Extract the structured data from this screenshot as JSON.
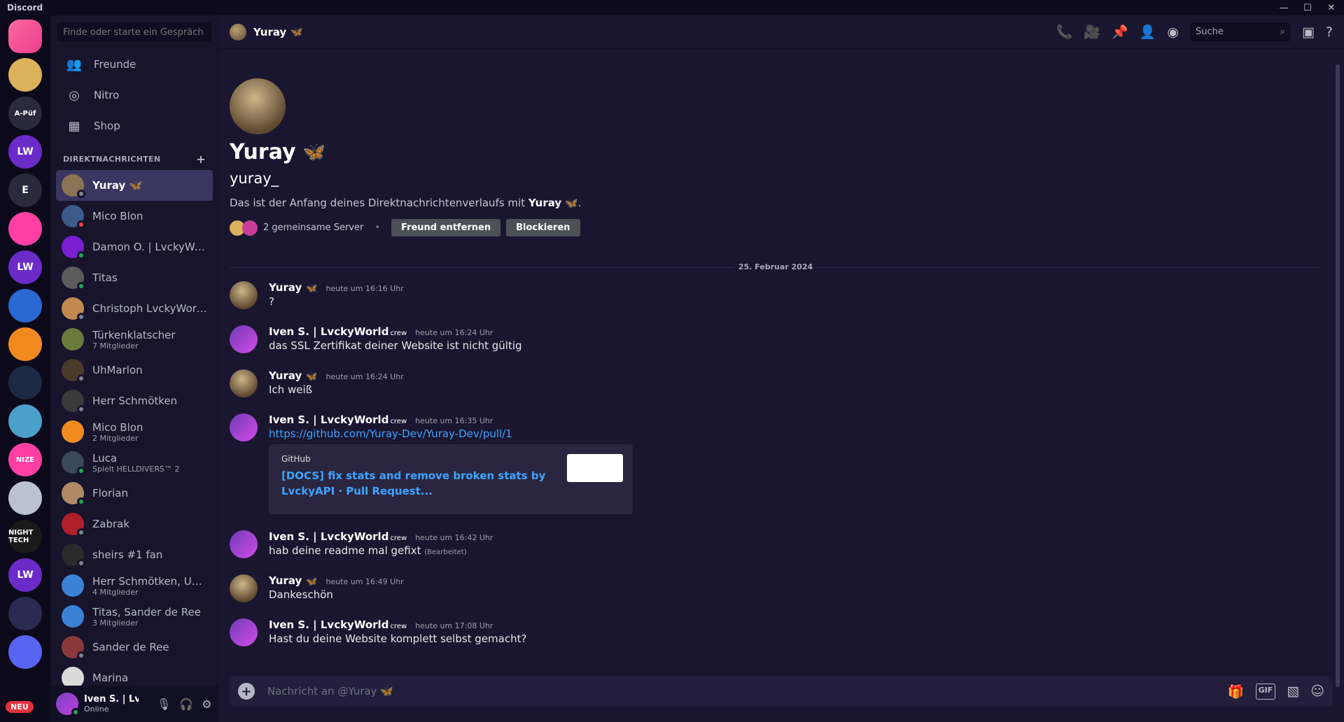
{
  "window": {
    "title": "Discord"
  },
  "servers": [
    {
      "label": "",
      "color": "#e93d8a",
      "dm": true
    },
    {
      "label": "",
      "color": "#d9b25a"
    },
    {
      "label": "A-Püf",
      "color": "#2b2a3d"
    },
    {
      "label": "LW",
      "color": "#6a2bc9"
    },
    {
      "label": "E",
      "color": "#2b2a3d"
    },
    {
      "label": "",
      "color": "#ff3fa3"
    },
    {
      "label": "LW",
      "color": "#6a2bc9"
    },
    {
      "label": "",
      "color": "#2a68d4"
    },
    {
      "label": "",
      "color": "#f08a1f"
    },
    {
      "label": "",
      "color": "#1d2944"
    },
    {
      "label": "",
      "color": "#4aa0c8"
    },
    {
      "label": "NIZE",
      "color": "#ff3fa3"
    },
    {
      "label": "",
      "color": "#b9c2ce"
    },
    {
      "label": "NIGHT TECH",
      "color": "#1a1a1a"
    },
    {
      "label": "LW",
      "color": "#6a2bc9"
    },
    {
      "label": "",
      "color": "#2a2a52"
    },
    {
      "label": "",
      "color": "#5865f2"
    }
  ],
  "neu_badge": "NEU",
  "sidebar": {
    "search_placeholder": "Finde oder starte ein Gespräch",
    "nav": [
      {
        "label": "Freunde"
      },
      {
        "label": "Nitro"
      },
      {
        "label": "Shop"
      }
    ],
    "dm_header": "DIREKTNACHRICHTEN",
    "dms": [
      {
        "name": "Yuray 🦋",
        "sub": "",
        "color": "#8a7456",
        "status": "#80848e",
        "active": true
      },
      {
        "name": "Mico Blon",
        "sub": "",
        "color": "#3c5b8a",
        "status": "#f23f43"
      },
      {
        "name": "Damon O. | LvckyWorl...",
        "sub": "",
        "color": "#7a1fd1",
        "status": "#23a55a"
      },
      {
        "name": "Titas",
        "sub": "",
        "color": "#5b5b5b",
        "status": "#23a55a"
      },
      {
        "name": "Christoph LvckyWorld...",
        "sub": "",
        "color": "#c28a4e",
        "status": "#80848e"
      },
      {
        "name": "Türkenklatscher",
        "sub": "7 Mitglieder",
        "color": "#6a7a3a",
        "status": ""
      },
      {
        "name": "UhMarlon",
        "sub": "",
        "color": "#4a3a2a",
        "status": "#80848e"
      },
      {
        "name": "Herr Schmötken",
        "sub": "",
        "color": "#3a3a3a",
        "status": "#80848e"
      },
      {
        "name": "Mico Blon",
        "sub": "2 Mitglieder",
        "color": "#f08a1f",
        "status": ""
      },
      {
        "name": "Luca",
        "sub": "Spielt HELLDIVERS™ 2",
        "color": "#3a4a5a",
        "status": "#23a55a"
      },
      {
        "name": "Florian",
        "sub": "",
        "color": "#b08a66",
        "status": "#23a55a"
      },
      {
        "name": "Zabrak",
        "sub": "",
        "color": "#b0202a",
        "status": "#80848e"
      },
      {
        "name": "sheirs #1 fan",
        "sub": "",
        "color": "#2a2a2a",
        "status": "#80848e"
      },
      {
        "name": "Herr Schmötken, Uh...",
        "sub": "4 Mitglieder",
        "color": "#3b82d6",
        "status": ""
      },
      {
        "name": "Titas, Sander de Ree",
        "sub": "3 Mitglieder",
        "color": "#3b82d6",
        "status": ""
      },
      {
        "name": "Sander de Ree",
        "sub": "",
        "color": "#8a3a3a",
        "status": "#80848e"
      },
      {
        "name": "Marina",
        "sub": "",
        "color": "#dadada",
        "status": ""
      }
    ]
  },
  "userbar": {
    "name": "Iven S. | Lv...",
    "status": "Online"
  },
  "chat": {
    "header_name": "Yuray",
    "header_emoji": "🦋",
    "search_label": "Suche",
    "intro": {
      "name": "Yuray",
      "emoji": "🦋",
      "handle": "yuray_",
      "text_prefix": "Das ist der Anfang deines Direktnachrichtenverlaufs mit",
      "text_name": "Yuray",
      "text_emoji": "🦋",
      "text_suffix": ".",
      "mutual": "2 gemeinsame Server",
      "dot": "•",
      "btn_remove": "Freund entfernen",
      "btn_block": "Blockieren"
    },
    "date_divider": "25. Februar 2024",
    "messages": [
      {
        "author": "Yuray",
        "emoji": "🦋",
        "tag": "",
        "time": "heute um 16:16 Uhr",
        "text": "?",
        "av": "yuray"
      },
      {
        "author": "Iven S. | LvckyWorld",
        "emoji": "",
        "tag": "crew",
        "time": "heute um 16:24 Uhr",
        "text": "das SSL Zertifikat deiner Website ist nicht gültig",
        "av": "iven"
      },
      {
        "author": "Yuray",
        "emoji": "🦋",
        "tag": "",
        "time": "heute um 16:24 Uhr",
        "text": "Ich weiß",
        "av": "yuray"
      },
      {
        "author": "Iven S. | LvckyWorld",
        "emoji": "",
        "tag": "crew",
        "time": "heute um 16:35 Uhr",
        "link": "https://github.com/Yuray-Dev/Yuray-Dev/pull/1",
        "embed_provider": "GitHub",
        "embed_title": "[DOCS] fix stats and remove broken stats by LvckyAPI · Pull Request...",
        "av": "iven"
      },
      {
        "author": "Iven S. | LvckyWorld",
        "emoji": "",
        "tag": "crew",
        "time": "heute um 16:42 Uhr",
        "text": "hab deine readme mal gefixt",
        "edited": "(Bearbeitet)",
        "av": "iven"
      },
      {
        "author": "Yuray",
        "emoji": "🦋",
        "tag": "",
        "time": "heute um 16:49 Uhr",
        "text": "Dankeschön",
        "av": "yuray"
      },
      {
        "author": "Iven S. | LvckyWorld",
        "emoji": "",
        "tag": "crew",
        "time": "heute um 17:08 Uhr",
        "text": "Hast du deine Website komplett selbst gemacht?",
        "av": "iven"
      }
    ],
    "composer_placeholder": "Nachricht an @Yuray 🦋",
    "gif_label": "GIF"
  }
}
